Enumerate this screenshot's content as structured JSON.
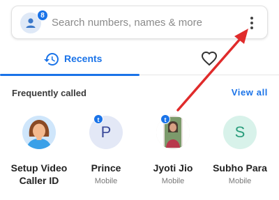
{
  "search": {
    "placeholder": "Search numbers, names & more",
    "badge_count": "8",
    "avatar_icon": "person-icon",
    "menu_icon": "kebab-menu-icon"
  },
  "tabs": {
    "recents_label": "Recents",
    "recents_icon": "history-icon",
    "favorites_icon": "heart-outline-icon"
  },
  "section": {
    "title": "Frequently called",
    "view_all": "View all"
  },
  "contacts": [
    {
      "name": "Setup Video Caller ID",
      "sub": "",
      "avatar": "illustration-avatar",
      "badge": ""
    },
    {
      "name": "Prince",
      "sub": "Mobile",
      "initial": "P",
      "badge": "t"
    },
    {
      "name": "Jyoti Jio",
      "sub": "Mobile",
      "avatar": "photo",
      "badge": "t"
    },
    {
      "name": "Subho Para",
      "sub": "Mobile",
      "initial": "S",
      "badge": ""
    }
  ],
  "colors": {
    "accent": "#1a73e8",
    "annotation_arrow": "#e02b2b"
  }
}
